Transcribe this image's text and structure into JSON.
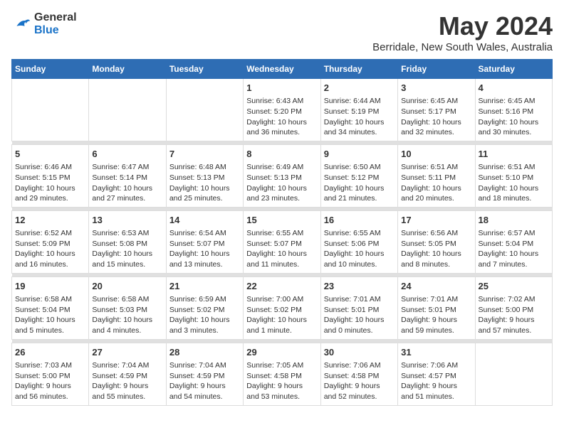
{
  "header": {
    "logo_line1": "General",
    "logo_line2": "Blue",
    "month_year": "May 2024",
    "location": "Berridale, New South Wales, Australia"
  },
  "weekdays": [
    "Sunday",
    "Monday",
    "Tuesday",
    "Wednesday",
    "Thursday",
    "Friday",
    "Saturday"
  ],
  "weeks": [
    [
      {
        "day": "",
        "info": ""
      },
      {
        "day": "",
        "info": ""
      },
      {
        "day": "",
        "info": ""
      },
      {
        "day": "1",
        "info": "Sunrise: 6:43 AM\nSunset: 5:20 PM\nDaylight: 10 hours\nand 36 minutes."
      },
      {
        "day": "2",
        "info": "Sunrise: 6:44 AM\nSunset: 5:19 PM\nDaylight: 10 hours\nand 34 minutes."
      },
      {
        "day": "3",
        "info": "Sunrise: 6:45 AM\nSunset: 5:17 PM\nDaylight: 10 hours\nand 32 minutes."
      },
      {
        "day": "4",
        "info": "Sunrise: 6:45 AM\nSunset: 5:16 PM\nDaylight: 10 hours\nand 30 minutes."
      }
    ],
    [
      {
        "day": "5",
        "info": "Sunrise: 6:46 AM\nSunset: 5:15 PM\nDaylight: 10 hours\nand 29 minutes."
      },
      {
        "day": "6",
        "info": "Sunrise: 6:47 AM\nSunset: 5:14 PM\nDaylight: 10 hours\nand 27 minutes."
      },
      {
        "day": "7",
        "info": "Sunrise: 6:48 AM\nSunset: 5:13 PM\nDaylight: 10 hours\nand 25 minutes."
      },
      {
        "day": "8",
        "info": "Sunrise: 6:49 AM\nSunset: 5:13 PM\nDaylight: 10 hours\nand 23 minutes."
      },
      {
        "day": "9",
        "info": "Sunrise: 6:50 AM\nSunset: 5:12 PM\nDaylight: 10 hours\nand 21 minutes."
      },
      {
        "day": "10",
        "info": "Sunrise: 6:51 AM\nSunset: 5:11 PM\nDaylight: 10 hours\nand 20 minutes."
      },
      {
        "day": "11",
        "info": "Sunrise: 6:51 AM\nSunset: 5:10 PM\nDaylight: 10 hours\nand 18 minutes."
      }
    ],
    [
      {
        "day": "12",
        "info": "Sunrise: 6:52 AM\nSunset: 5:09 PM\nDaylight: 10 hours\nand 16 minutes."
      },
      {
        "day": "13",
        "info": "Sunrise: 6:53 AM\nSunset: 5:08 PM\nDaylight: 10 hours\nand 15 minutes."
      },
      {
        "day": "14",
        "info": "Sunrise: 6:54 AM\nSunset: 5:07 PM\nDaylight: 10 hours\nand 13 minutes."
      },
      {
        "day": "15",
        "info": "Sunrise: 6:55 AM\nSunset: 5:07 PM\nDaylight: 10 hours\nand 11 minutes."
      },
      {
        "day": "16",
        "info": "Sunrise: 6:55 AM\nSunset: 5:06 PM\nDaylight: 10 hours\nand 10 minutes."
      },
      {
        "day": "17",
        "info": "Sunrise: 6:56 AM\nSunset: 5:05 PM\nDaylight: 10 hours\nand 8 minutes."
      },
      {
        "day": "18",
        "info": "Sunrise: 6:57 AM\nSunset: 5:04 PM\nDaylight: 10 hours\nand 7 minutes."
      }
    ],
    [
      {
        "day": "19",
        "info": "Sunrise: 6:58 AM\nSunset: 5:04 PM\nDaylight: 10 hours\nand 5 minutes."
      },
      {
        "day": "20",
        "info": "Sunrise: 6:58 AM\nSunset: 5:03 PM\nDaylight: 10 hours\nand 4 minutes."
      },
      {
        "day": "21",
        "info": "Sunrise: 6:59 AM\nSunset: 5:02 PM\nDaylight: 10 hours\nand 3 minutes."
      },
      {
        "day": "22",
        "info": "Sunrise: 7:00 AM\nSunset: 5:02 PM\nDaylight: 10 hours\nand 1 minute."
      },
      {
        "day": "23",
        "info": "Sunrise: 7:01 AM\nSunset: 5:01 PM\nDaylight: 10 hours\nand 0 minutes."
      },
      {
        "day": "24",
        "info": "Sunrise: 7:01 AM\nSunset: 5:01 PM\nDaylight: 9 hours\nand 59 minutes."
      },
      {
        "day": "25",
        "info": "Sunrise: 7:02 AM\nSunset: 5:00 PM\nDaylight: 9 hours\nand 57 minutes."
      }
    ],
    [
      {
        "day": "26",
        "info": "Sunrise: 7:03 AM\nSunset: 5:00 PM\nDaylight: 9 hours\nand 56 minutes."
      },
      {
        "day": "27",
        "info": "Sunrise: 7:04 AM\nSunset: 4:59 PM\nDaylight: 9 hours\nand 55 minutes."
      },
      {
        "day": "28",
        "info": "Sunrise: 7:04 AM\nSunset: 4:59 PM\nDaylight: 9 hours\nand 54 minutes."
      },
      {
        "day": "29",
        "info": "Sunrise: 7:05 AM\nSunset: 4:58 PM\nDaylight: 9 hours\nand 53 minutes."
      },
      {
        "day": "30",
        "info": "Sunrise: 7:06 AM\nSunset: 4:58 PM\nDaylight: 9 hours\nand 52 minutes."
      },
      {
        "day": "31",
        "info": "Sunrise: 7:06 AM\nSunset: 4:57 PM\nDaylight: 9 hours\nand 51 minutes."
      },
      {
        "day": "",
        "info": ""
      }
    ]
  ]
}
